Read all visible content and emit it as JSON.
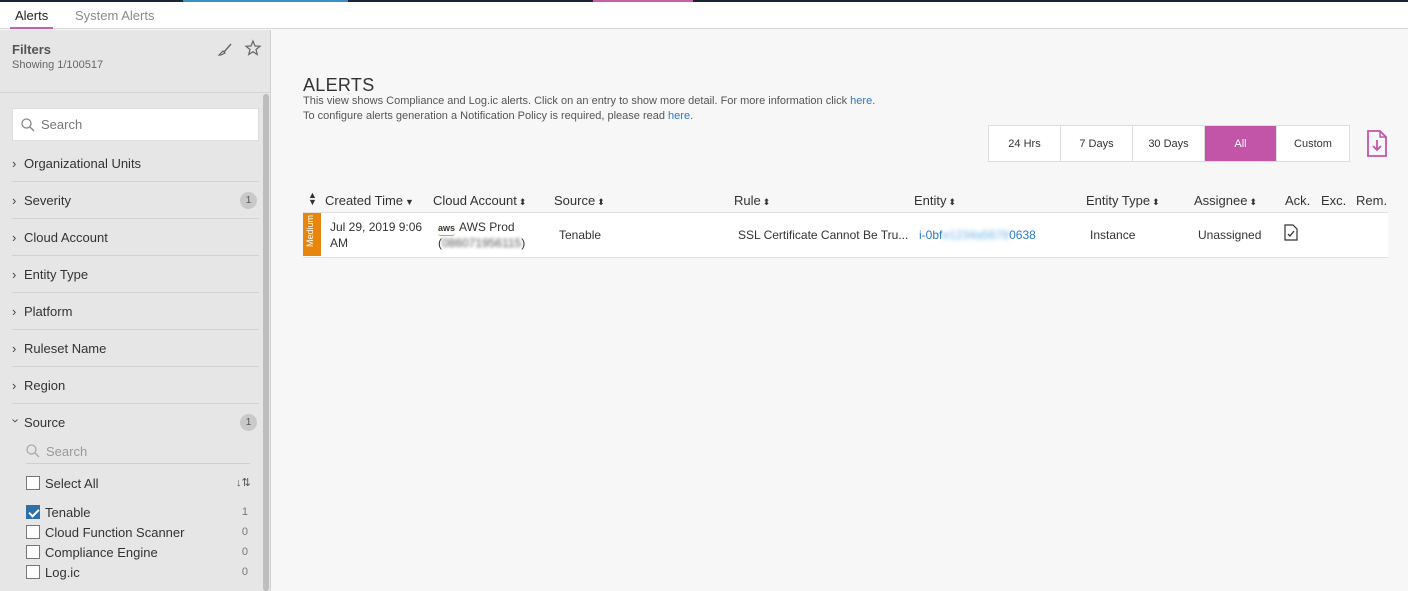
{
  "tabs": [
    {
      "label": "Alerts",
      "active": true
    },
    {
      "label": "System Alerts",
      "active": false
    }
  ],
  "sidebar": {
    "title": "Filters",
    "subtitle": "Showing 1/100517",
    "search_placeholder": "Search",
    "facets": [
      {
        "label": "Organizational Units",
        "count": ""
      },
      {
        "label": "Severity",
        "count": "1"
      },
      {
        "label": "Cloud Account",
        "count": ""
      },
      {
        "label": "Entity Type",
        "count": ""
      },
      {
        "label": "Platform",
        "count": ""
      },
      {
        "label": "Ruleset Name",
        "count": ""
      },
      {
        "label": "Region",
        "count": ""
      },
      {
        "label": "Source",
        "count": "1",
        "expanded": true
      }
    ],
    "source_filter": {
      "search_placeholder": "Search",
      "select_all_label": "Select All",
      "options": [
        {
          "label": "Tenable",
          "count": "1",
          "checked": true
        },
        {
          "label": "Cloud Function Scanner",
          "count": "0",
          "checked": false
        },
        {
          "label": "Compliance Engine",
          "count": "0",
          "checked": false
        },
        {
          "label": "Log.ic",
          "count": "0",
          "checked": false
        }
      ]
    }
  },
  "main": {
    "title": "ALERTS",
    "desc1": "This view shows Compliance and Log.ic alerts. Click on an entry to show more detail. For more information click",
    "desc2": "To configure alerts generation a Notification Policy is required, please read",
    "here_label": "here",
    "time_ranges": [
      "24 Hrs",
      "7 Days",
      "30 Days",
      "All",
      "Custom"
    ],
    "active_range": "All",
    "accent_color": "#c255a8"
  },
  "table": {
    "columns": [
      "Created Time",
      "Cloud Account",
      "Source",
      "Rule",
      "Entity",
      "Entity Type",
      "Assignee",
      "Ack.",
      "Exc.",
      "Rem."
    ],
    "rows": [
      {
        "severity": "Medium",
        "created_line1": "Jul 29, 2019 9:06",
        "created_line2": "AM",
        "aws_logo": "aws",
        "account_name": "AWS Prod",
        "account_id_open": "(",
        "account_id": "086071956115",
        "account_id_close": ")",
        "source": "Tenable",
        "rule": "SSL Certificate Cannot Be Tru...",
        "entity_prefix": "i-0bf",
        "entity_hidden": "e1234a5678",
        "entity_suffix": "0638",
        "entity_type": "Instance",
        "assignee": "Unassigned"
      }
    ]
  }
}
